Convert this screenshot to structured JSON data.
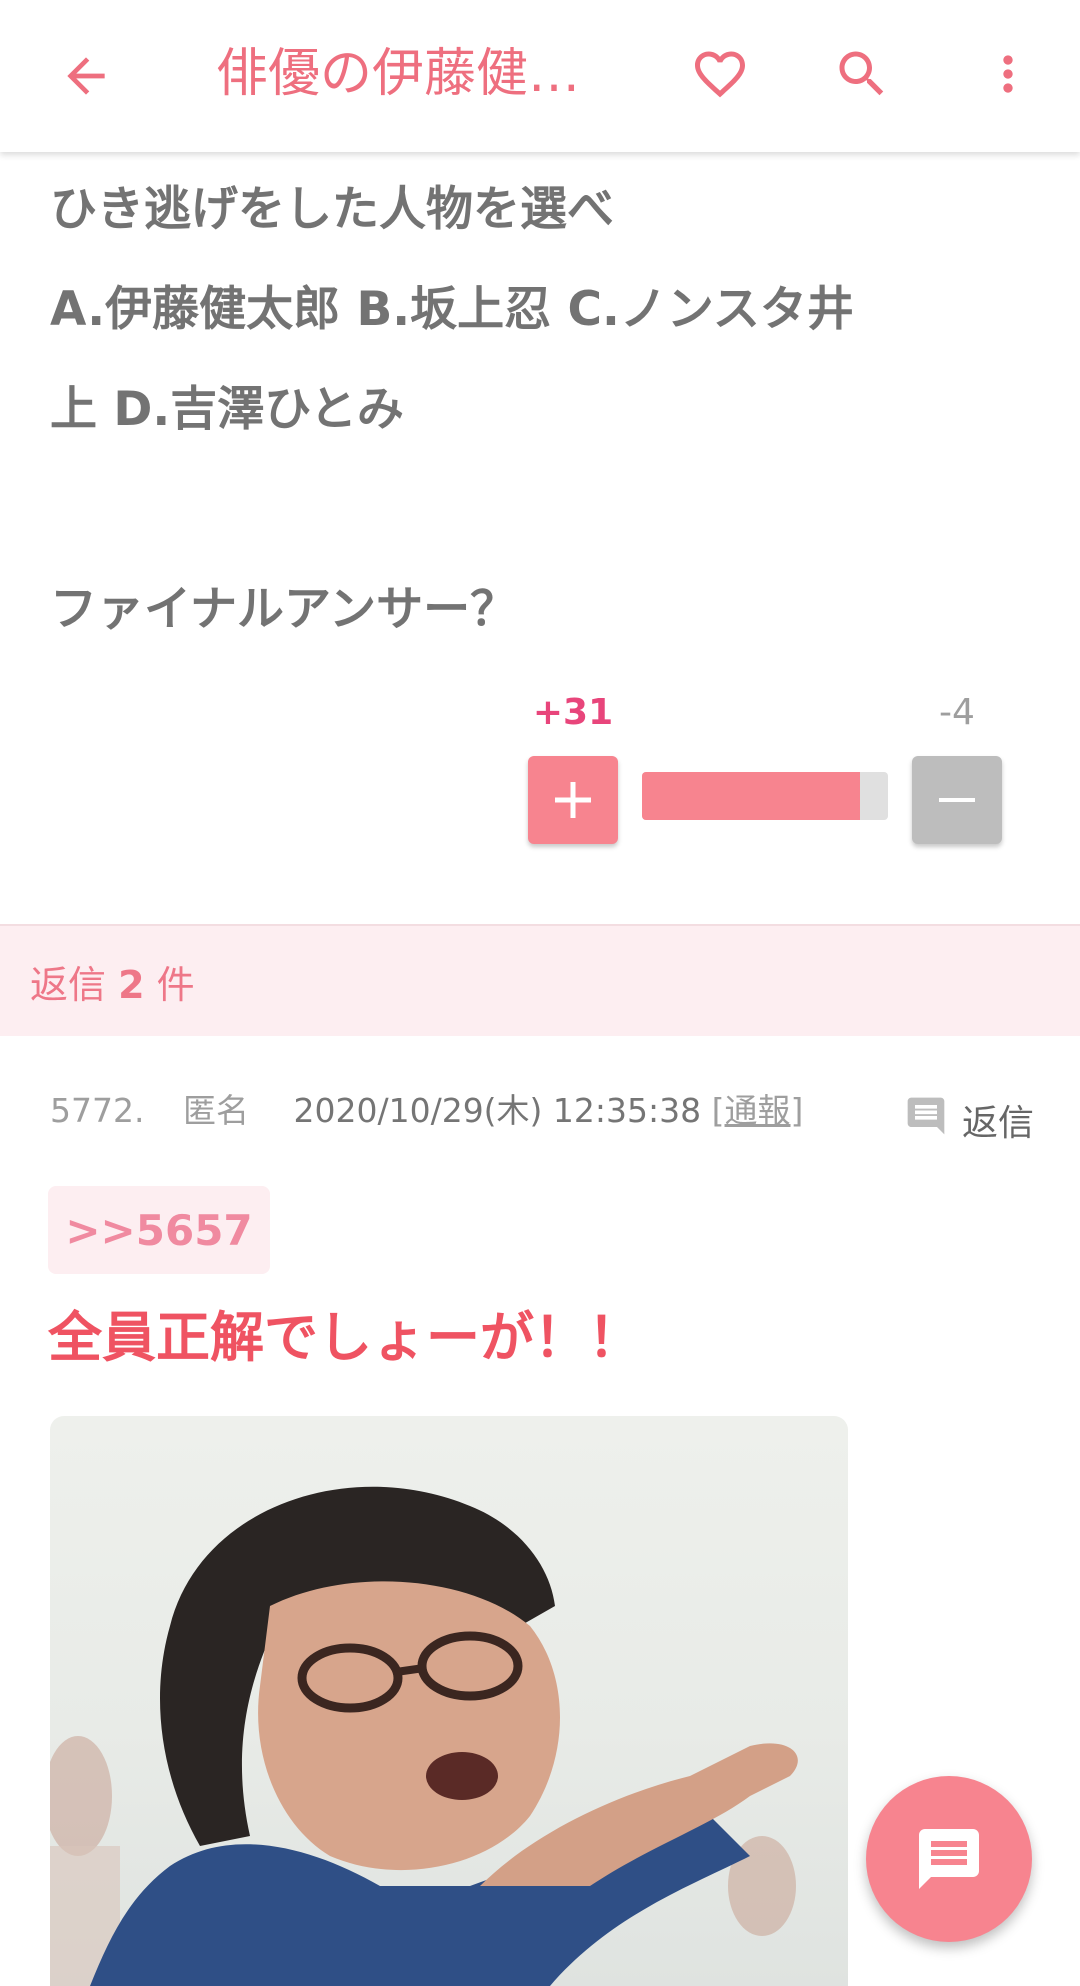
{
  "appbar": {
    "title": "俳優の伊藤健…",
    "back_icon": "arrow-left-icon",
    "favorite_icon": "heart-outline-icon",
    "search_icon": "search-icon",
    "more_icon": "more-vertical-icon",
    "accent_color": "#ee6f7f"
  },
  "comment": {
    "lines": [
      "ひき逃げをした人物を選べ",
      "A.伊藤健太郎 B.坂上忍 C.ノンスタ井",
      "上 D.吉澤ひとみ",
      "",
      "ファイナルアンサー？"
    ],
    "votes": {
      "plus_count": "+31",
      "minus_count": "-4",
      "plus_ratio": 0.886,
      "plus_color": "#f7848f",
      "minus_color": "#bdbdbd"
    }
  },
  "replies": {
    "prefix": "返信",
    "count": "2",
    "suffix": "件"
  },
  "reply": {
    "number": "5772.",
    "author": "匿名",
    "datetime": "2020/10/29(木) 12:35:38",
    "report_open": "[",
    "report_label": "通報",
    "report_close": "]",
    "reply_label": "返信",
    "anchor": ">>5657",
    "text": "全員正解でしょーが！！",
    "text_color": "#ef5362"
  },
  "fab": {
    "icon": "comment-icon"
  }
}
